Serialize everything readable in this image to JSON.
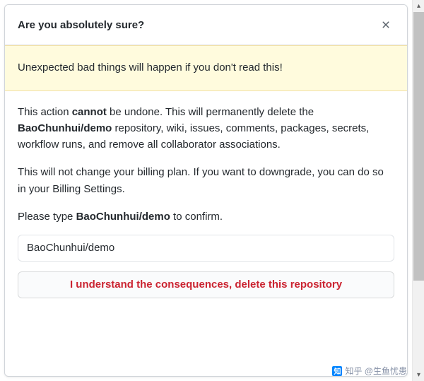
{
  "dialog": {
    "title": "Are you absolutely sure?",
    "warning": "Unexpected bad things will happen if you don't read this!",
    "body": {
      "p1_pre": "This action ",
      "p1_cannot": "cannot",
      "p1_mid": " be undone. This will permanently delete the ",
      "p1_repo": "BaoChunhui/demo",
      "p1_post": " repository, wiki, issues, comments, packages, secrets, workflow runs, and remove all collaborator associations.",
      "p2": "This will not change your billing plan. If you want to downgrade, you can do so in your Billing Settings.",
      "p3_pre": "Please type ",
      "p3_repo": "BaoChunhui/demo",
      "p3_post": " to confirm."
    },
    "input_value": "BaoChunhui/demo",
    "delete_label": "I understand the consequences, delete this repository"
  },
  "watermark": {
    "logo": "知",
    "text": "知乎 @生鱼忧患"
  }
}
